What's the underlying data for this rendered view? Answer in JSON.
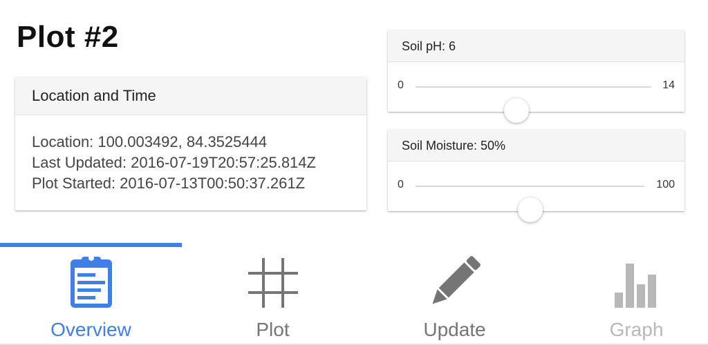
{
  "page": {
    "title": "Plot #2"
  },
  "location_card": {
    "header": "Location and Time",
    "location": "Location: 100.003492, 84.3525444",
    "last_updated": "Last Updated: 2016-07-19T20:57:25.814Z",
    "plot_started": "Plot Started: 2016-07-13T00:50:37.261Z"
  },
  "soil_ph": {
    "header": "Soil pH: 6",
    "min_label": "0",
    "max_label": "14",
    "min": 0,
    "max": 14,
    "value": 6
  },
  "soil_moisture": {
    "header": "Soil Moisture: 50%",
    "min_label": "0",
    "max_label": "100",
    "min": 0,
    "max": 100,
    "value": 50
  },
  "tabs": [
    {
      "label": "Overview",
      "icon": "clipboard-icon",
      "state": "active",
      "color": "#3f7fe6"
    },
    {
      "label": "Plot",
      "icon": "grid-icon",
      "state": "normal",
      "color": "#757575"
    },
    {
      "label": "Update",
      "icon": "pencil-icon",
      "state": "normal",
      "color": "#757575"
    },
    {
      "label": "Graph",
      "icon": "bar-chart-icon",
      "state": "disabled",
      "color": "#b8b8b8"
    }
  ],
  "colors": {
    "accent": "#3f7fe6",
    "inactive_tab": "#757575",
    "disabled_tab": "#b8b8b8"
  }
}
